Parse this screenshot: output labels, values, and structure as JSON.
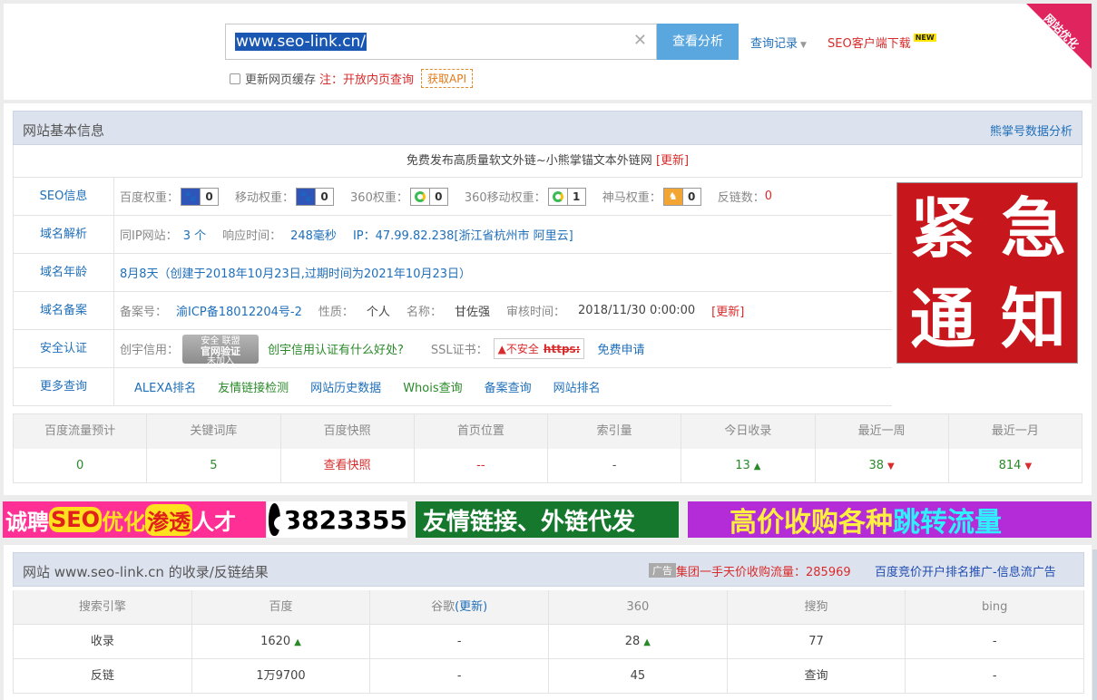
{
  "search": {
    "value": "www.seo-link.cn/",
    "analyze_button": "查看分析",
    "history_link": "查询记录",
    "client_download": "SEO客户端下载",
    "new_badge": "NEW",
    "corner_ribbon": "网站优化",
    "cache_label": "更新网页缓存",
    "note": "注：开放内页查询",
    "api_button": "获取API"
  },
  "info": {
    "title": "网站基本信息",
    "header_link": "熊掌号数据分析",
    "promo_text": "免费发布高质量软文外链~小熊掌锚文本外链网",
    "promo_update": "[更新]",
    "seo": {
      "label": "SEO信息",
      "baidu_weight_label": "百度权重：",
      "baidu_weight": "0",
      "mobile_weight_label": "移动权重：",
      "mobile_weight": "0",
      "w360_label": "360权重：",
      "w360": "0",
      "w360_mobile_label": "360移动权重：",
      "w360_mobile": "1",
      "shenma_label": "神马权重：",
      "shenma": "0",
      "backlinks_label": "反链数：",
      "backlinks": "0"
    },
    "domain_resolve": {
      "label": "域名解析",
      "same_ip_label": "同IP网站：",
      "same_ip": "3 个",
      "response_label": "响应时间：",
      "response": "248毫秒",
      "ip": "IP：47.99.82.238[浙江省杭州市 阿里云]"
    },
    "domain_age": {
      "label": "域名年龄",
      "value": "8月8天（创建于2018年10月23日,过期时间为2021年10月23日）"
    },
    "icp": {
      "label": "域名备案",
      "number_label": "备案号：",
      "number": "渝ICP备18012204号-2",
      "nature_label": "性质：",
      "nature": "个人",
      "name_label": "名称：",
      "name": "甘佐强",
      "audit_label": "审核时间：",
      "audit": "2018/11/30 0:00:00",
      "update": "[更新]"
    },
    "security": {
      "label": "安全认证",
      "credit_label": "创宇信用：",
      "badge_top": "安全 联盟",
      "badge_main": "官网验证",
      "badge_bottom": "未加入",
      "credit_link": "创宇信用认证有什么好处?",
      "ssl_label": "SSL证书：",
      "ssl_status": "不安全",
      "ssl_proto": "https:",
      "ssl_apply": "免费申请"
    },
    "more": {
      "label": "更多查询",
      "links": [
        "ALEXA排名",
        "友情链接检测",
        "网站历史数据",
        "Whois查询",
        "备案查询",
        "网站排名"
      ]
    },
    "notice": [
      "紧",
      "急",
      "通",
      "知"
    ]
  },
  "stats": {
    "headers": [
      "百度流量预计",
      "关键词库",
      "百度快照",
      "首页位置",
      "索引量",
      "今日收录",
      "最近一周",
      "最近一月"
    ],
    "values": [
      "0",
      "5",
      "查看快照",
      "--",
      "-",
      "13",
      "38",
      "814"
    ]
  },
  "banners": {
    "b1_pre": "诚聘",
    "b1_seo": "SEO",
    "b1_mid": "优化",
    "b1_hl": "渗透",
    "b1_post": "人才",
    "b2": "3823355",
    "b3": "友情链接、外链代发",
    "b4_a": "高价收购各种",
    "b4_b": "跳转流量"
  },
  "results": {
    "title": "网站 www.seo-link.cn 的收录/反链结果",
    "ad_tag": "广告",
    "ad1": "集团一手天价收购流量：285969",
    "ad2": "百度竞价开户排名推广-信息流广告",
    "headers": [
      "搜索引擎",
      "百度",
      "谷歌",
      "360",
      "搜狗",
      "bing"
    ],
    "google_update": "(更新)",
    "rows": [
      [
        "收录",
        "1620",
        "-",
        "28",
        "77",
        "-"
      ],
      [
        "反链",
        "1万9700",
        "-",
        "45",
        "查询",
        "-"
      ]
    ]
  }
}
